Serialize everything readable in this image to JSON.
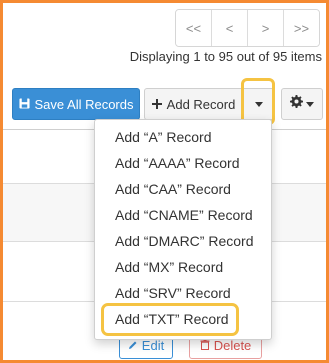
{
  "pager": {
    "first": "<<",
    "prev": "<",
    "next": ">",
    "last": ">>"
  },
  "records_info": "Displaying 1 to 95 out of 95 items",
  "toolbar": {
    "save_all_label": "Save All Records",
    "add_record_label": "Add Record"
  },
  "add_record_menu": {
    "items": [
      "Add “A” Record",
      "Add “AAAA” Record",
      "Add “CAA” Record",
      "Add “CNAME” Record",
      "Add “DMARC” Record",
      "Add “MX” Record",
      "Add “SRV” Record",
      "Add “TXT” Record"
    ]
  },
  "row_actions": {
    "edit_label": "Edit",
    "delete_label": "Delete"
  },
  "colors": {
    "frame_border": "#f58a32",
    "primary": "#3a8fd6",
    "highlight": "#f5c342",
    "danger": "#d9534f"
  },
  "icons": [
    "floppy-disk-icon",
    "plus-icon",
    "caret-down-icon",
    "gear-icon",
    "pencil-icon",
    "trash-icon"
  ]
}
